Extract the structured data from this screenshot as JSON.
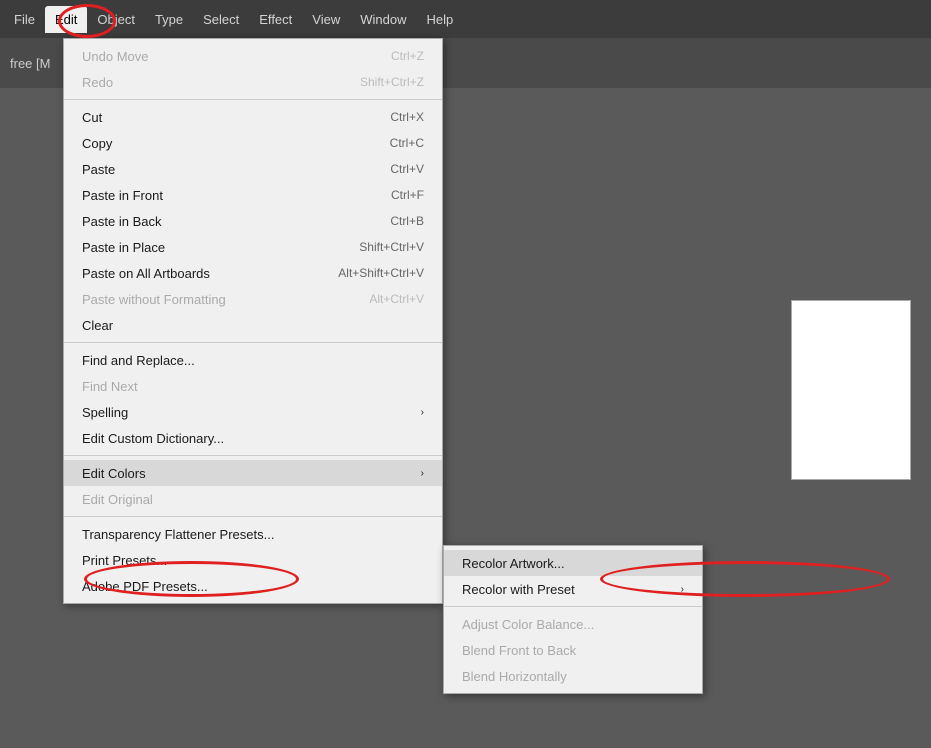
{
  "menubar": {
    "items": [
      {
        "label": "File",
        "id": "file"
      },
      {
        "label": "Edit",
        "id": "edit",
        "active": true
      },
      {
        "label": "Object",
        "id": "object"
      },
      {
        "label": "Type",
        "id": "type"
      },
      {
        "label": "Select",
        "id": "select"
      },
      {
        "label": "Effect",
        "id": "effect"
      },
      {
        "label": "View",
        "id": "view"
      },
      {
        "label": "Window",
        "id": "window"
      },
      {
        "label": "Help",
        "id": "help"
      }
    ]
  },
  "titlebar": {
    "text": "free [M"
  },
  "edit_menu": {
    "items": [
      {
        "id": "undo",
        "label": "Undo Move",
        "shortcut": "Ctrl+Z",
        "disabled": true
      },
      {
        "id": "redo",
        "label": "Redo",
        "shortcut": "Shift+Ctrl+Z",
        "disabled": true
      },
      {
        "id": "sep1",
        "type": "separator"
      },
      {
        "id": "cut",
        "label": "Cut",
        "shortcut": "Ctrl+X"
      },
      {
        "id": "copy",
        "label": "Copy",
        "shortcut": "Ctrl+C"
      },
      {
        "id": "paste",
        "label": "Paste",
        "shortcut": "Ctrl+V"
      },
      {
        "id": "paste-front",
        "label": "Paste in Front",
        "shortcut": "Ctrl+F"
      },
      {
        "id": "paste-back",
        "label": "Paste in Back",
        "shortcut": "Ctrl+B"
      },
      {
        "id": "paste-place",
        "label": "Paste in Place",
        "shortcut": "Shift+Ctrl+V"
      },
      {
        "id": "paste-all",
        "label": "Paste on All Artboards",
        "shortcut": "Alt+Shift+Ctrl+V"
      },
      {
        "id": "paste-no-format",
        "label": "Paste without Formatting",
        "shortcut": "Alt+Ctrl+V",
        "disabled": true
      },
      {
        "id": "clear",
        "label": "Clear",
        "shortcut": ""
      },
      {
        "id": "sep2",
        "type": "separator"
      },
      {
        "id": "find-replace",
        "label": "Find and Replace...",
        "shortcut": ""
      },
      {
        "id": "find-next",
        "label": "Find Next",
        "shortcut": "",
        "disabled": true
      },
      {
        "id": "spelling",
        "label": "Spelling",
        "shortcut": "",
        "arrow": "›"
      },
      {
        "id": "edit-dict",
        "label": "Edit Custom Dictionary...",
        "shortcut": ""
      },
      {
        "id": "sep3",
        "type": "separator"
      },
      {
        "id": "edit-colors",
        "label": "Edit Colors",
        "shortcut": "",
        "arrow": "›",
        "highlighted": true
      },
      {
        "id": "edit-original",
        "label": "Edit Original",
        "shortcut": "",
        "disabled": true
      },
      {
        "id": "sep4",
        "type": "separator"
      },
      {
        "id": "transparency",
        "label": "Transparency Flattener Presets...",
        "shortcut": ""
      },
      {
        "id": "print-presets",
        "label": "Print Presets...",
        "shortcut": ""
      },
      {
        "id": "adobe-pdf",
        "label": "Adobe PDF Presets...",
        "shortcut": ""
      }
    ]
  },
  "submenu": {
    "items": [
      {
        "id": "recolor-artwork",
        "label": "Recolor Artwork...",
        "highlighted": true
      },
      {
        "id": "recolor-preset",
        "label": "Recolor with Preset",
        "arrow": "›"
      },
      {
        "id": "sep1",
        "type": "separator"
      },
      {
        "id": "adjust-color",
        "label": "Adjust Color Balance...",
        "disabled": true
      },
      {
        "id": "blend-front",
        "label": "Blend Front to Back",
        "disabled": true
      },
      {
        "id": "blend-horiz",
        "label": "Blend Horizontally",
        "disabled": true
      }
    ]
  },
  "annotations": {
    "edit_circle": {
      "label": "Edit menu circle"
    },
    "edit_colors_circle": {
      "label": "Edit Colors circle"
    },
    "recolor_circle": {
      "label": "Recolor Artwork circle"
    }
  }
}
